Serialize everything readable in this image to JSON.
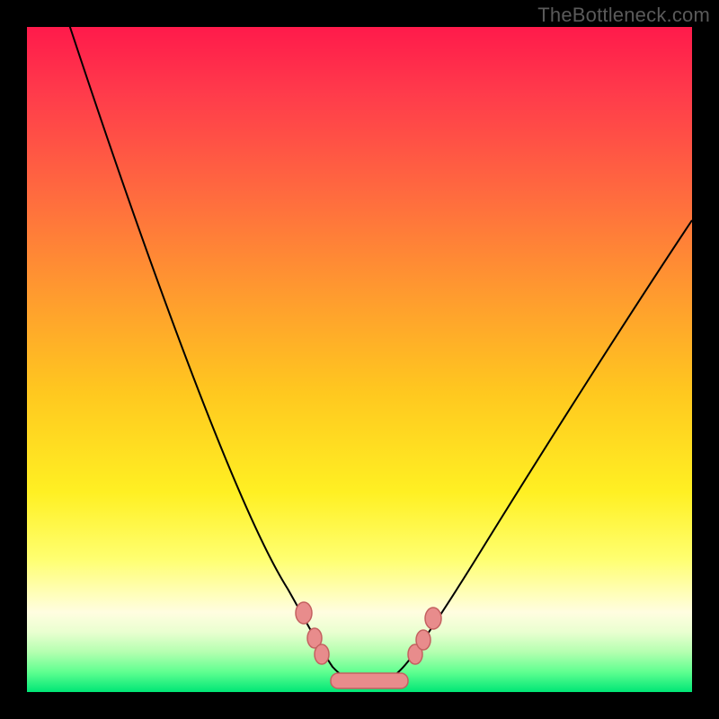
{
  "attribution": "TheBottleneck.com",
  "colors": {
    "gradient_top": "#ff1a4b",
    "gradient_mid": "#fff023",
    "gradient_bottom": "#00e676",
    "curve": "#000000",
    "dots_fill": "#e88c8c",
    "dots_stroke": "#c46060",
    "background": "#000000"
  },
  "chart_data": {
    "type": "line",
    "title": "",
    "xlabel": "",
    "ylabel": "",
    "xlim": [
      0,
      100
    ],
    "ylim": [
      0,
      105
    ],
    "series": [
      {
        "name": "bottleneck-curve",
        "x": [
          5,
          10,
          15,
          20,
          25,
          30,
          35,
          40,
          42,
          45,
          48,
          50,
          52,
          55,
          58,
          60,
          65,
          70,
          75,
          80,
          85,
          90,
          95,
          100
        ],
        "y": [
          105,
          92,
          80,
          67,
          54,
          42,
          28,
          16,
          11,
          6,
          2,
          1,
          1,
          2,
          4,
          7,
          14,
          22,
          30,
          38,
          46,
          54,
          62,
          70
        ]
      }
    ],
    "highlight_points": [
      {
        "x": 42,
        "y": 11
      },
      {
        "x": 44,
        "y": 7
      },
      {
        "x": 45,
        "y": 5
      },
      {
        "x": 48,
        "y": 2
      },
      {
        "x": 50,
        "y": 1
      },
      {
        "x": 52,
        "y": 1
      },
      {
        "x": 55,
        "y": 2
      },
      {
        "x": 58,
        "y": 5
      },
      {
        "x": 59,
        "y": 8
      },
      {
        "x": 61,
        "y": 11
      }
    ]
  }
}
